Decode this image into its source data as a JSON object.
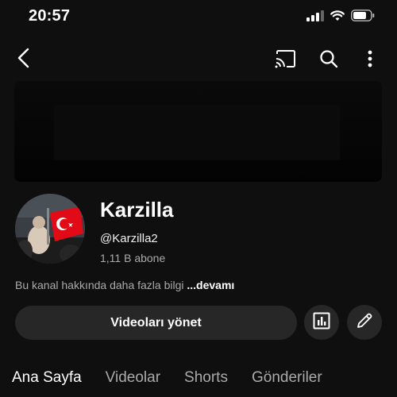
{
  "status_bar": {
    "time": "20:57",
    "signal_icon": "signal-bars-icon",
    "wifi_icon": "wifi-icon",
    "battery_icon": "battery-icon"
  },
  "top_bar": {
    "back_icon": "chevron-left-icon",
    "cast_icon": "cast-icon",
    "search_icon": "search-icon",
    "more_icon": "more-vertical-icon"
  },
  "channel": {
    "name": "Karzilla",
    "handle": "@Karzilla2",
    "subscribers": "1,11 B abone",
    "about_text": "Bu kanal hakkında daha fazla bilgi ",
    "about_more": "...devamı"
  },
  "actions": {
    "manage_videos_label": "Videoları yönet",
    "analytics_icon": "bar-chart-icon",
    "edit_icon": "pencil-icon"
  },
  "tabs": [
    {
      "label": "Ana Sayfa",
      "active": true
    },
    {
      "label": "Videolar",
      "active": false
    },
    {
      "label": "Shorts",
      "active": false
    },
    {
      "label": "Gönderiler",
      "active": false
    }
  ],
  "colors": {
    "background": "#0f0f0f",
    "button_bg": "#272727",
    "muted_text": "#aaaaaa",
    "flag_red": "#e30a17"
  }
}
